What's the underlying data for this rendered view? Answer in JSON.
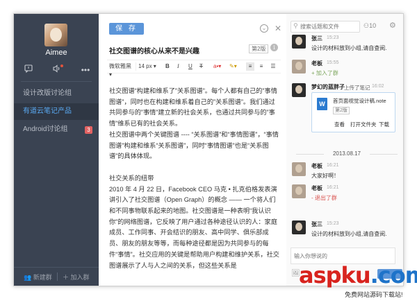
{
  "sidebar": {
    "username": "Aimee",
    "icons": [
      "chat-icon",
      "speaker-icon",
      "more-icon"
    ],
    "groups": [
      {
        "label": "设计改版讨论组",
        "active": false,
        "badge": ""
      },
      {
        "label": "有道云笔记产品",
        "active": true,
        "badge": ""
      },
      {
        "label": "Android讨论组",
        "active": false,
        "badge": "3"
      }
    ],
    "footer": {
      "new_group": "新建群",
      "join_group": "加入群"
    }
  },
  "editor": {
    "save_label": "保 存",
    "title": "社交图谱的核心从来不是兴趣",
    "version": "第2版",
    "toolbar": {
      "font": "微软雅黑",
      "size": "14 px",
      "bold": "B",
      "italic": "I",
      "underline": "U",
      "strike": "T"
    },
    "paragraphs": [
      "社交图谱“构建和维系了”关系图谱”。每个人都有自己的”事情图谱”，同时也在构建和维系着自己的”关系图谱”。我们通过共同参与的”事情”建立新的社会关系，也通过共同参与的”事情”维系已有的社会关系。",
      "社交图谱中两个关键图谱 ---- “关系图谱”和“事情图谱”，“事情图谱”构建和维系“关系图谱”，同时“事情图谱”也是“关系图谱”的具体体现。",
      "社交关系的纽带",
      "2010 年 4 月 22 日，Facebook CEO 马克 • 扎克伯格发表演讲引入了社交图谱（Open Graph）的概念 —— 一个将人们和不同事物联系起来的地图。社交图谱是一种表明“我认识你”的网络图谱，它反映了用户通过各种途径认识的人：家庭成员、工作同事、开会结识的朋友、高中同学、俱乐部成员、朋友的朋友等等，而每种途径都是因为共同参与的每件“事情”。社交应用的关键是帮助用户构建和维护关系，社交图谱展示了人与人之间的关系，但这些关系是"
    ]
  },
  "chat": {
    "search_placeholder": "搜索话题和文件",
    "member_count": "10",
    "messages": [
      {
        "name": "张三",
        "time": "15:23",
        "text": "设计的材料放到小组,请自查阅."
      },
      {
        "name": "老板",
        "time": "15:55",
        "system": "+ 加入了群"
      },
      {
        "name": "梦幻的蓝胖子",
        "action": "上传了笔记",
        "time": "16:02",
        "file": {
          "name": "首页面视觉设计稿.note",
          "version": "第2版",
          "actions": [
            "查看",
            "打开文件夹",
            "下载"
          ]
        }
      },
      {
        "name": "老板",
        "time": "16:21",
        "text": "大家好啊！"
      },
      {
        "name": "老板",
        "time": "16:21",
        "system": "- 退出了群"
      },
      {
        "name": "张三",
        "time": "15:23",
        "text": "设计的材料放到小组,请自查阅."
      }
    ],
    "date_separator": "2013.08.17",
    "input_placeholder": "输入你想说的"
  },
  "watermark": {
    "brand": "aspku",
    "brand_tld": ".com",
    "tagline": "免费网站源码下载站!"
  }
}
